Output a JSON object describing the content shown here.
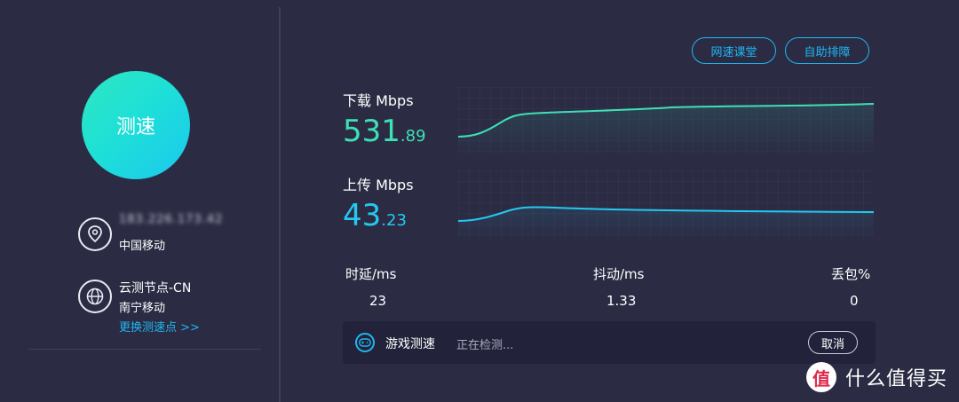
{
  "left": {
    "speed_button": "测速",
    "ip_address": "183.226.173.42",
    "isp": "中国移动",
    "node_name": "云测节点-CN",
    "node_isp": "南宁移动",
    "change_node": "更换测速点 >>"
  },
  "header": {
    "course_button": "网速课堂",
    "troubleshoot_button": "自助排障"
  },
  "download": {
    "label": "下载 Mbps",
    "value_int": "531",
    "value_dec": ".89",
    "color": "#3ee0b6"
  },
  "upload": {
    "label": "上传 Mbps",
    "value_int": "43",
    "value_dec": ".23",
    "color": "#26c8f0"
  },
  "stats": {
    "latency_label": "时延/ms",
    "latency_value": "23",
    "jitter_label": "抖动/ms",
    "jitter_value": "1.33",
    "loss_label": "丢包%",
    "loss_value": "0"
  },
  "game": {
    "title": "游戏测速",
    "status": "正在检测...",
    "cancel": "取消"
  },
  "watermark": {
    "logo": "值",
    "text": "什么值得买"
  }
}
